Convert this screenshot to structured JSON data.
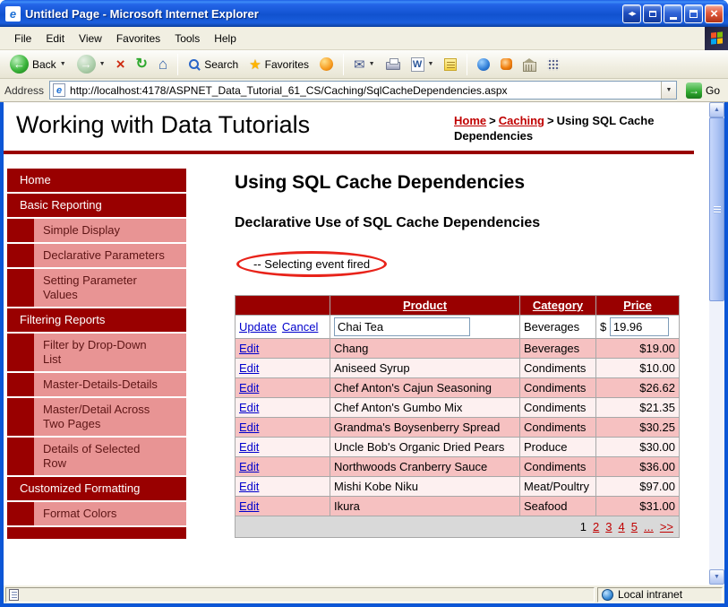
{
  "window": {
    "title": "Untitled Page - Microsoft Internet Explorer"
  },
  "menubar": {
    "items": [
      "File",
      "Edit",
      "View",
      "Favorites",
      "Tools",
      "Help"
    ]
  },
  "toolbar": {
    "back_label": "Back",
    "search_label": "Search",
    "favorites_label": "Favorites"
  },
  "addressbar": {
    "label": "Address",
    "url": "http://localhost:4178/ASPNET_Data_Tutorial_61_CS/Caching/SqlCacheDependencies.aspx",
    "go_label": "Go"
  },
  "page": {
    "site_title": "Working with Data Tutorials",
    "breadcrumb": {
      "home": "Home",
      "separator": ">",
      "section": "Caching",
      "current": "Using SQL Cache Dependencies"
    },
    "sidebar": [
      {
        "label": "Home"
      },
      {
        "label": "Basic Reporting"
      },
      {
        "label": "Simple Display"
      },
      {
        "label": "Declarative Parameters"
      },
      {
        "label": "Setting Parameter Values"
      },
      {
        "label": "Filtering Reports"
      },
      {
        "label": "Filter by Drop-Down List"
      },
      {
        "label": "Master-Details-Details"
      },
      {
        "label": "Master/Detail Across Two Pages"
      },
      {
        "label": "Details of Selected Row"
      },
      {
        "label": "Customized Formatting"
      },
      {
        "label": "Format Colors"
      }
    ],
    "main": {
      "heading": "Using SQL Cache Dependencies",
      "subheading": "Declarative Use of SQL Cache Dependencies",
      "event_message": "-- Selecting event fired",
      "grid": {
        "headers": {
          "product": "Product",
          "category": "Category",
          "price": "Price"
        },
        "edit_label": "Edit",
        "edit_row": {
          "update": "Update",
          "cancel": "Cancel",
          "product_value": "Chai Tea",
          "category": "Beverages",
          "currency": "$",
          "price_value": "19.96"
        },
        "rows": [
          {
            "product": "Chang",
            "category": "Beverages",
            "price": "$19.00"
          },
          {
            "product": "Aniseed Syrup",
            "category": "Condiments",
            "price": "$10.00"
          },
          {
            "product": "Chef Anton's Cajun Seasoning",
            "category": "Condiments",
            "price": "$26.62"
          },
          {
            "product": "Chef Anton's Gumbo Mix",
            "category": "Condiments",
            "price": "$21.35"
          },
          {
            "product": "Grandma's Boysenberry Spread",
            "category": "Condiments",
            "price": "$30.25"
          },
          {
            "product": "Uncle Bob's Organic Dried Pears",
            "category": "Produce",
            "price": "$30.00"
          },
          {
            "product": "Northwoods Cranberry Sauce",
            "category": "Condiments",
            "price": "$36.00"
          },
          {
            "product": "Mishi Kobe Niku",
            "category": "Meat/Poultry",
            "price": "$97.00"
          },
          {
            "product": "Ikura",
            "category": "Seafood",
            "price": "$31.00"
          }
        ],
        "pager": {
          "current": "1",
          "links": [
            "2",
            "3",
            "4",
            "5",
            "...",
            ">>"
          ]
        }
      }
    }
  },
  "statusbar": {
    "zone": "Local intranet"
  },
  "icons": {
    "ie_letter": "e",
    "word_letter": "W",
    "back_arrow": "←",
    "forward_arrow": "→",
    "stop": "×",
    "refresh": "↻",
    "home": "⌂",
    "favorites_star": "★",
    "mail": "✉",
    "dropdown": "▼",
    "up_arrow": "▲",
    "down_arrow": "▼",
    "go_arrow": "→",
    "close": "×",
    "extra_arrows": "◂▸"
  },
  "colors": {
    "title_bar_blue": "#1456D0",
    "chrome_tan": "#F1EFE2",
    "theme_dark_red": "#990000",
    "sidebar_pink": "#E89494",
    "row_pink": "#F6C1C1",
    "row_light": "#FDF0F0",
    "link_blue": "#0000CC",
    "link_red": "#C00000",
    "annotation_red": "#E8231A",
    "pager_gray": "#D9D9D9"
  }
}
